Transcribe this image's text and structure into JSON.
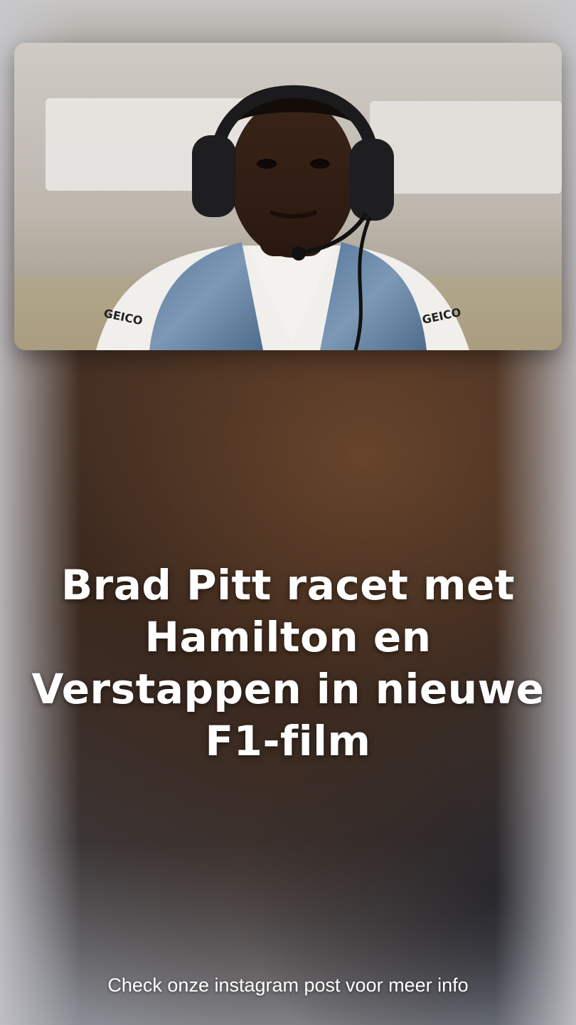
{
  "headline": "Brad Pitt racet met Hamilton en Verstappen in nieuwe F1-film",
  "footer_text": "Check onze instagram post voor meer info",
  "colors": {
    "text": "#ffffff",
    "background_warm": "#4a3426",
    "background_cool": "#3b3a3e"
  }
}
